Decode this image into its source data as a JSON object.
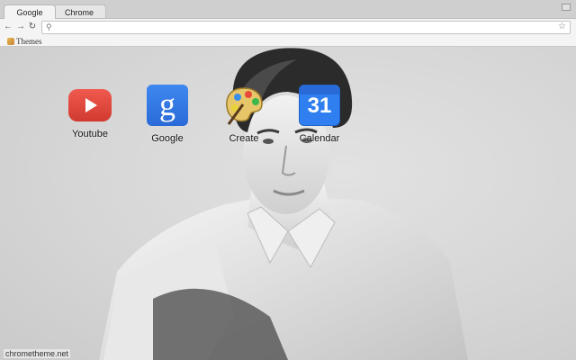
{
  "tabs": [
    {
      "label": "Google",
      "active": true
    },
    {
      "label": "Chrome",
      "active": false
    }
  ],
  "toolbar": {
    "back_icon": "arrow-left-icon",
    "forward_icon": "arrow-right-icon",
    "reload_icon": "reload-icon",
    "omnibox_value": "",
    "search_icon": "magnifier-icon",
    "star_icon": "star-icon"
  },
  "bookmarks": [
    {
      "label": "Themes",
      "icon": "themes-icon"
    }
  ],
  "apps": [
    {
      "label": "Youtube",
      "icon": "youtube-icon",
      "color": "#e0463b"
    },
    {
      "label": "Google",
      "icon": "google-g-icon",
      "glyph": "g",
      "color": "#3a7ee8"
    },
    {
      "label": "Create",
      "icon": "palette-icon"
    },
    {
      "label": "Calendar",
      "icon": "calendar-icon",
      "glyph": "31",
      "color": "#2f7ff0"
    }
  ],
  "footer": {
    "text": "chrometheme.net"
  }
}
